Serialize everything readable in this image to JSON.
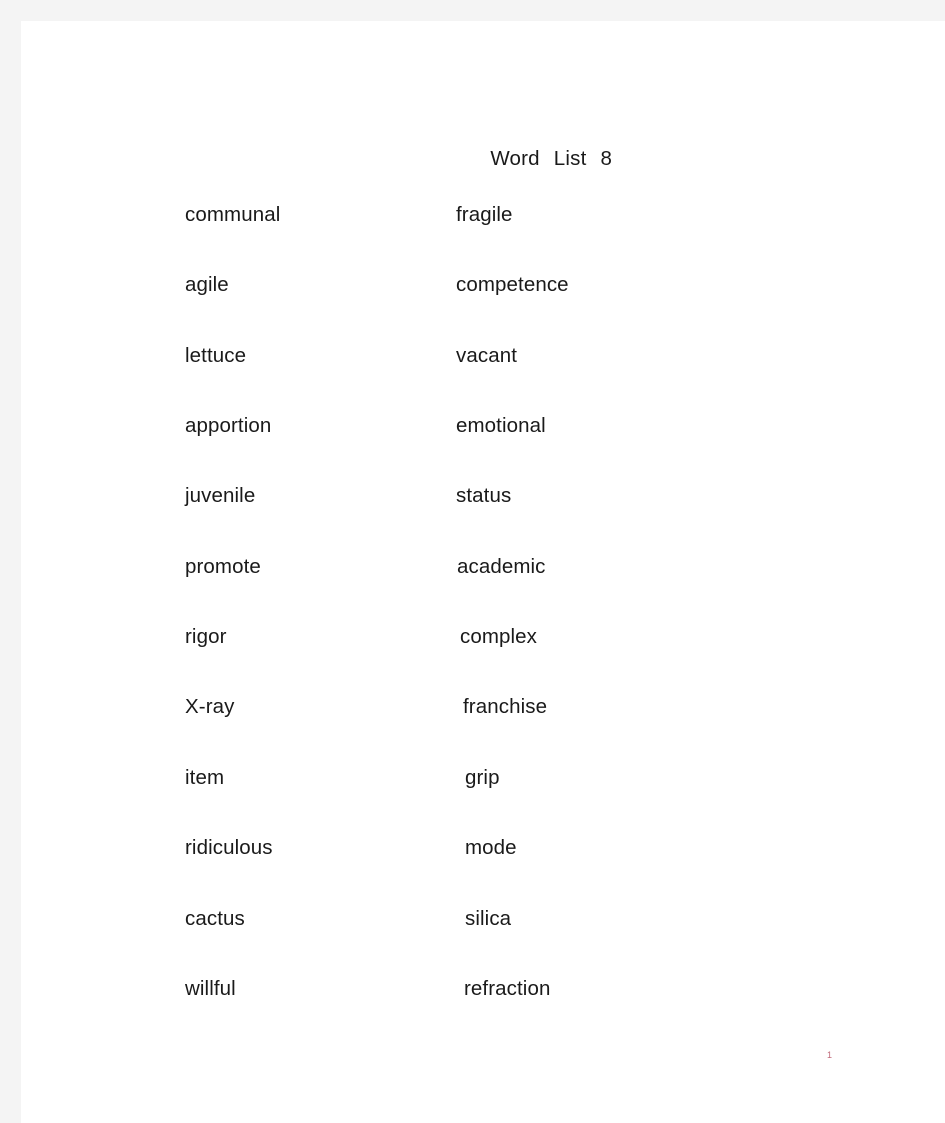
{
  "page": {
    "background_color": "#f4f4f4",
    "sheet_color": "#ffffff",
    "text_color": "#1a1a1a"
  },
  "document": {
    "title_parts": {
      "word": "Word",
      "list": "List",
      "number": "8"
    },
    "title_full": "Word   List   8",
    "page_number": "1",
    "page_number_color": "#c06a7a"
  },
  "word_list": {
    "columns": 2,
    "rows": 12,
    "left_column": [
      "communal",
      "agile",
      "lettuce",
      "apportion",
      "juvenile",
      "promote",
      "rigor",
      "X-ray",
      "item",
      "ridiculous",
      "cactus",
      "willful"
    ],
    "right_column": [
      "fragile",
      "competence",
      "vacant",
      "emotional",
      "status",
      "academic",
      "complex",
      "franchise",
      "grip",
      "mode",
      "silica",
      "refraction"
    ]
  },
  "layout": {
    "row_tops": [
      179,
      249,
      320,
      390,
      460,
      531,
      601,
      671,
      742,
      812,
      883,
      953
    ],
    "left_indents": [
      21,
      21,
      21,
      21,
      21,
      21,
      21,
      21,
      21,
      21,
      21,
      21
    ],
    "right_indents": [
      22,
      22,
      22,
      22,
      22,
      23,
      26,
      29,
      31,
      31,
      31,
      30
    ]
  }
}
